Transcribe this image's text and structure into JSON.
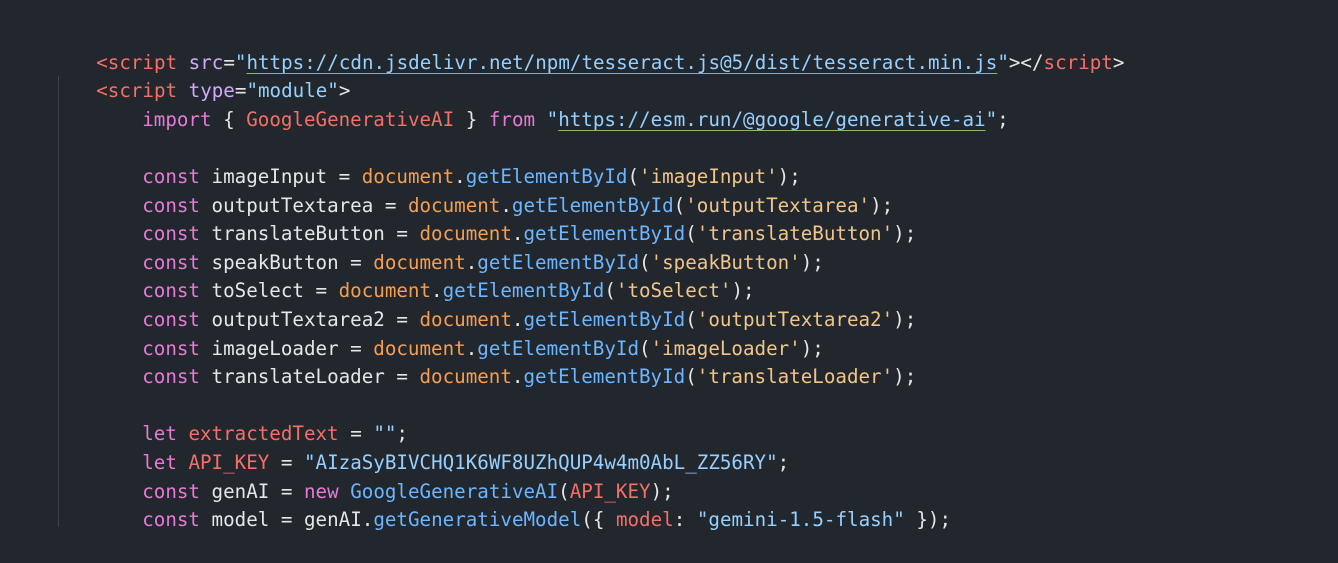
{
  "editor": {
    "line1": {
      "open_tag": "<script",
      "attr": "src",
      "eq": "=",
      "q1": "\"",
      "url": "https://cdn.jsdelivr.net/npm/tesseract.js@5/dist/tesseract.min.js",
      "q2": "\"",
      "close": "></",
      "close_name": "script",
      "end": ">"
    },
    "line2": {
      "open_tag": "<script",
      "attr": "type",
      "eq": "=",
      "value": "\"module\"",
      "end": ">"
    },
    "import": {
      "kw": "import",
      "lb": "{",
      "name": "GoogleGenerativeAI",
      "rb": "}",
      "from": "from",
      "q1": "\"",
      "url": "https://esm.run/@google/generative-ai",
      "q2": "\"",
      "semi": ";"
    },
    "consts": [
      {
        "kw": "const",
        "name": "imageInput",
        "obj": "document",
        "fn": "getElementById",
        "arg": "'imageInput'"
      },
      {
        "kw": "const",
        "name": "outputTextarea",
        "obj": "document",
        "fn": "getElementById",
        "arg": "'outputTextarea'"
      },
      {
        "kw": "const",
        "name": "translateButton",
        "obj": "document",
        "fn": "getElementById",
        "arg": "'translateButton'"
      },
      {
        "kw": "const",
        "name": "speakButton",
        "obj": "document",
        "fn": "getElementById",
        "arg": "'speakButton'"
      },
      {
        "kw": "const",
        "name": "toSelect",
        "obj": "document",
        "fn": "getElementById",
        "arg": "'toSelect'"
      },
      {
        "kw": "const",
        "name": "outputTextarea2",
        "obj": "document",
        "fn": "getElementById",
        "arg": "'outputTextarea2'"
      },
      {
        "kw": "const",
        "name": "imageLoader",
        "obj": "document",
        "fn": "getElementById",
        "arg": "'imageLoader'"
      },
      {
        "kw": "const",
        "name": "translateLoader",
        "obj": "document",
        "fn": "getElementById",
        "arg": "'translateLoader'"
      }
    ],
    "let1": {
      "kw": "let",
      "name": "extractedText",
      "eq": "=",
      "value": "\"\"",
      "semi": ";"
    },
    "let2": {
      "kw": "let",
      "name": "API_KEY",
      "eq": "=",
      "value": "\"AIzaSyBIVCHQ1K6WF8UZhQUP4w4m0AbL_ZZ56RY\"",
      "semi": ";"
    },
    "genai": {
      "kw": "const",
      "name": "genAI",
      "eq": "=",
      "new": "new",
      "cls": "GoogleGenerativeAI",
      "lp": "(",
      "arg": "API_KEY",
      "rp": ")",
      "semi": ";"
    },
    "model": {
      "kw": "const",
      "name": "model",
      "eq": "=",
      "obj": "genAI",
      "dot": ".",
      "fn": "getGenerativeModel",
      "lp": "(",
      "lb": "{",
      "prop": "model",
      "colon": ":",
      "value": "\"gemini-1.5-flash\"",
      "rb": "}",
      "rp": ")",
      "semi": ";"
    },
    "colors": {
      "background": "#22272e",
      "tag": "#f47067",
      "string": "#96d0ff",
      "keyword": "#e67ad6",
      "function": "#6cb6ff",
      "object": "#f69d50",
      "single_quote_string": "#f0c58a"
    }
  }
}
